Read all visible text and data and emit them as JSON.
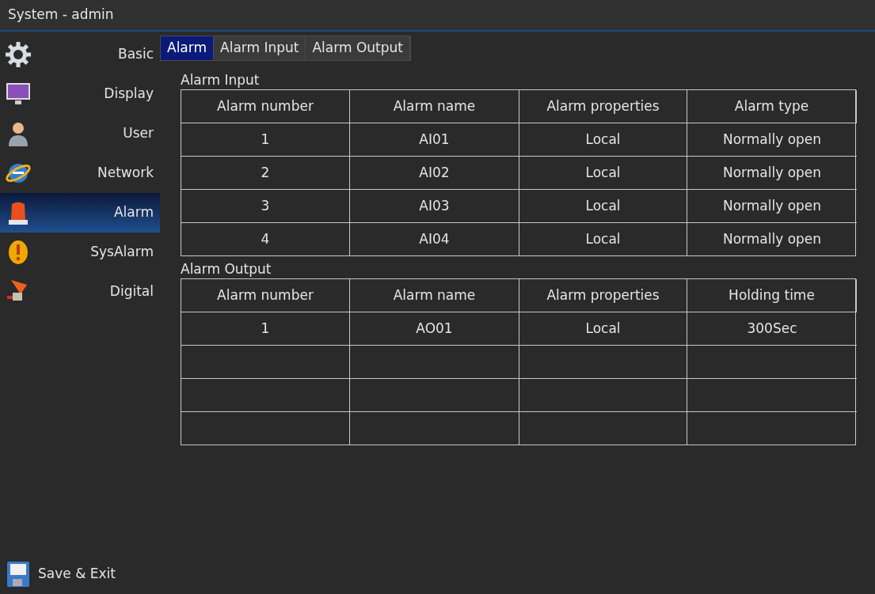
{
  "window": {
    "title": "System - admin"
  },
  "sidebar": {
    "items": [
      {
        "label": "Basic",
        "kind": "gear",
        "selected": false
      },
      {
        "label": "Display",
        "kind": "monitor",
        "selected": false
      },
      {
        "label": "User",
        "kind": "user",
        "selected": false
      },
      {
        "label": "Network",
        "kind": "globe",
        "selected": false
      },
      {
        "label": "Alarm",
        "kind": "siren",
        "selected": true
      },
      {
        "label": "SysAlarm",
        "kind": "warning",
        "selected": false
      },
      {
        "label": "Digital",
        "kind": "camera",
        "selected": false
      }
    ],
    "save_exit": "Save & Exit"
  },
  "tabs": [
    {
      "label": "Alarm",
      "selected": true
    },
    {
      "label": "Alarm Input",
      "selected": false
    },
    {
      "label": "Alarm Output",
      "selected": false
    }
  ],
  "sections": [
    {
      "title": "Alarm Input",
      "columns": [
        "Alarm number",
        "Alarm name",
        "Alarm properties",
        "Alarm type"
      ],
      "rows": [
        {
          "blank": false,
          "cells": [
            "1",
            "AI01",
            "Local",
            "Normally open"
          ]
        },
        {
          "blank": false,
          "cells": [
            "2",
            "AI02",
            "Local",
            "Normally open"
          ]
        },
        {
          "blank": false,
          "cells": [
            "3",
            "AI03",
            "Local",
            "Normally open"
          ]
        },
        {
          "blank": false,
          "cells": [
            "4",
            "AI04",
            "Local",
            "Normally open"
          ]
        }
      ]
    },
    {
      "title": "Alarm Output",
      "columns": [
        "Alarm number",
        "Alarm name",
        "Alarm properties",
        "Holding time"
      ],
      "rows": [
        {
          "blank": false,
          "cells": [
            "1",
            "AO01",
            "Local",
            "300Sec"
          ]
        },
        {
          "blank": true
        },
        {
          "blank": true
        },
        {
          "blank": true
        }
      ]
    }
  ]
}
